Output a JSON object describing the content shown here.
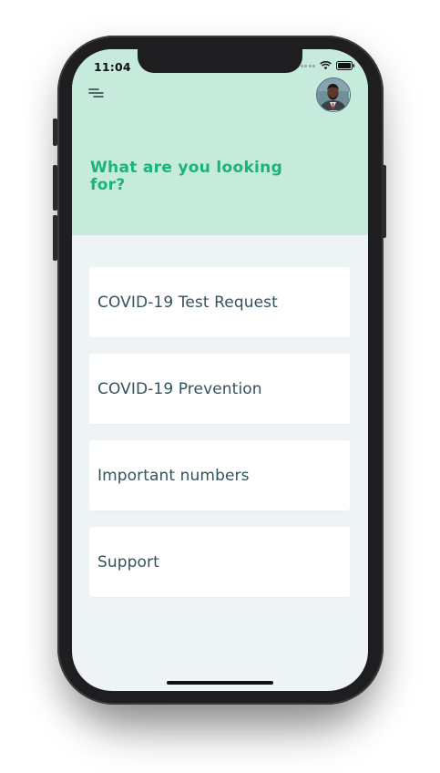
{
  "status_bar": {
    "time": "11:04",
    "icons": [
      "signal-icon",
      "wifi-icon",
      "battery-icon"
    ]
  },
  "header": {
    "menu_icon": "menu-icon",
    "avatar_icon": "profile-avatar",
    "title": "What are you looking for?"
  },
  "menu": {
    "items": [
      {
        "label": "COVID-19 Test Request"
      },
      {
        "label": "COVID-19 Prevention"
      },
      {
        "label": "Important numbers"
      },
      {
        "label": "Support"
      }
    ]
  },
  "colors": {
    "header_bg": "#c6eadb",
    "title": "#1bb37a",
    "screen_bg": "#eef3f6",
    "card_bg": "#ffffff",
    "card_text": "#34525c"
  }
}
